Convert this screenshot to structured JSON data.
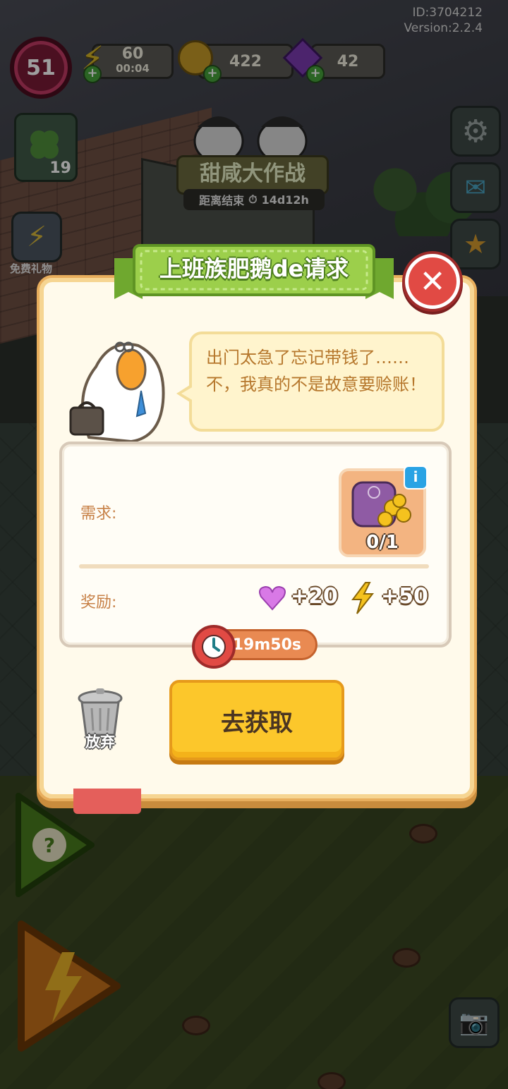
{
  "hud": {
    "account_id": "ID:3704212",
    "version": "Version:2.2.4",
    "level": "51",
    "energy": "60",
    "energy_timer": "00:04",
    "coins": "422",
    "gems": "42",
    "left_badge_count": "19",
    "free_gift_label": "免费礼物"
  },
  "event": {
    "title": "甜咸大作战",
    "countdown_label": "距离结束",
    "countdown_value": "14d12h"
  },
  "dialog": {
    "title": "上班族肥鹅de请求",
    "speech": "出门太急了忘记带钱了……不，我真的不是故意要赊账！",
    "requirement_label": "需求:",
    "requirement_item": "coin-bag",
    "requirement_progress": "0/1",
    "reward_label": "奖励:",
    "reward_hearts": "+20",
    "reward_energy": "+50",
    "timer": "19m50s",
    "go_button": "去获取",
    "abandon_label": "放弃"
  },
  "colors": {
    "accent_yellow": "#fcc72b",
    "close_red": "#e14a44",
    "ribbon_green": "#8cc63f",
    "label_brown": "#c78046"
  }
}
